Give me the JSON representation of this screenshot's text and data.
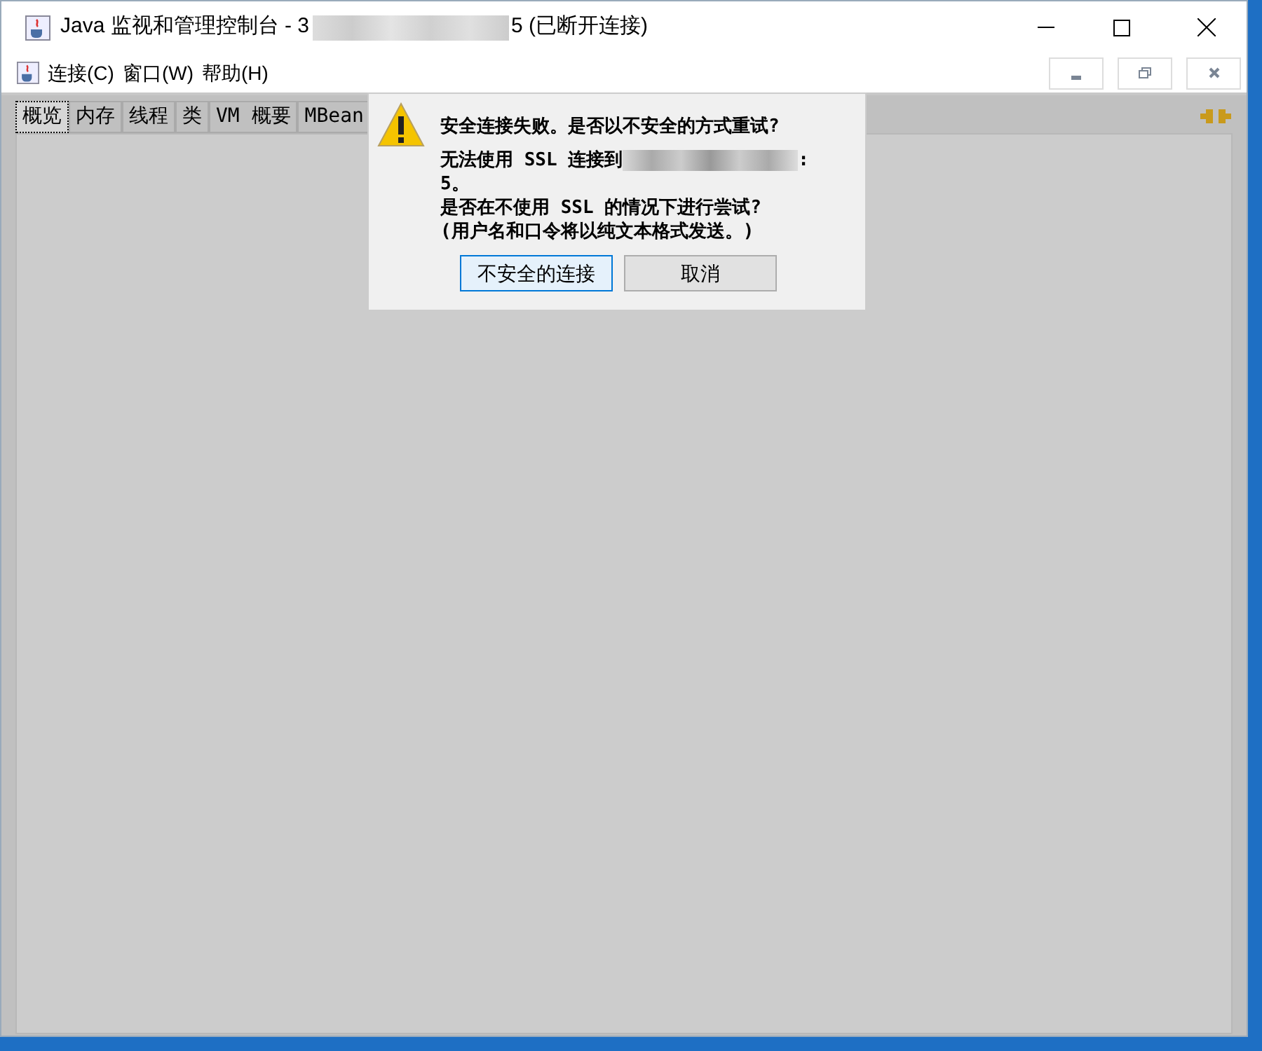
{
  "window": {
    "title_before": "Java 监视和管理控制台 - 3",
    "title_after": "5 (已断开连接)"
  },
  "menu": [
    {
      "label": "连接(C)"
    },
    {
      "label": "窗口(W)"
    },
    {
      "label": "帮助(H)"
    }
  ],
  "tabs": [
    {
      "label": "概览",
      "selected": true
    },
    {
      "label": "内存",
      "selected": false
    },
    {
      "label": "线程",
      "selected": false
    },
    {
      "label": "类",
      "selected": false
    },
    {
      "label": "VM 概要",
      "selected": false
    },
    {
      "label": "MBean",
      "selected": false
    }
  ],
  "dialog": {
    "heading": "安全连接失败。是否以不安全的方式重试?",
    "line_1_before": "无法使用 SSL 连接到",
    "line_1_after": ":",
    "line_2": "5。",
    "line_3": "是否在不使用 SSL 的情况下进行尝试?",
    "line_4": "(用户名和口令将以纯文本格式发送。)",
    "buttons": [
      {
        "label": "不安全的连接",
        "selected": true
      },
      {
        "label": "取消",
        "selected": false
      }
    ]
  }
}
